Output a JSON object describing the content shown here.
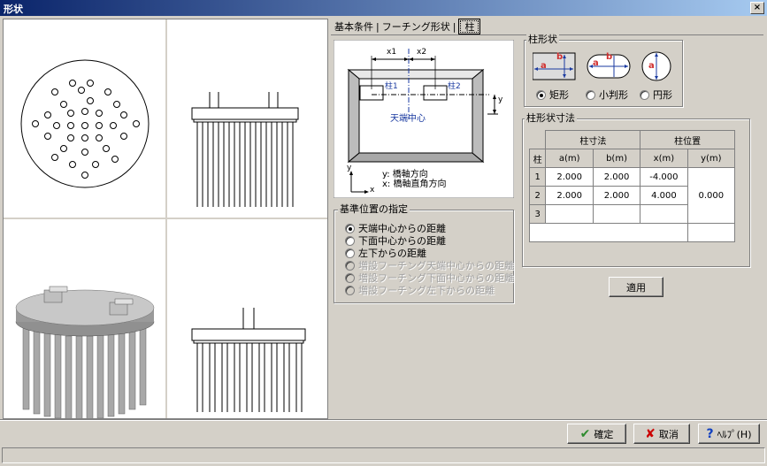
{
  "window": {
    "title": "形状",
    "close_glyph": "×"
  },
  "tabs": [
    {
      "label": "基本条件"
    },
    {
      "label": "フーチング形状"
    },
    {
      "label": "柱"
    }
  ],
  "diagram": {
    "x1": "x1",
    "x2": "x2",
    "y": "y",
    "col1": "柱1",
    "col2": "柱2",
    "center": "天端中心",
    "axis_y": "y",
    "axis_x": "x",
    "legend_y": "y: 橋軸方向",
    "legend_x": "x: 橋軸直角方向"
  },
  "column_shape": {
    "label": "柱形状",
    "icon_a": "a",
    "icon_b": "b",
    "options": [
      {
        "label": "矩形",
        "selected": true
      },
      {
        "label": "小判形",
        "selected": false
      },
      {
        "label": "円形",
        "selected": false
      }
    ]
  },
  "column_dims": {
    "label": "柱形状寸法",
    "header_col": "柱",
    "header_size": "柱寸法",
    "header_pos": "柱位置",
    "header_a": "a(m)",
    "header_b": "b(m)",
    "header_x": "x(m)",
    "header_y": "y(m)",
    "rows": [
      {
        "no": "1",
        "a": "2.000",
        "b": "2.000",
        "x": "-4.000"
      },
      {
        "no": "2",
        "a": "2.000",
        "b": "2.000",
        "x": "4.000"
      },
      {
        "no": "3",
        "a": "",
        "b": "",
        "x": ""
      }
    ],
    "y_value": "0.000"
  },
  "reference": {
    "label": "基準位置の指定",
    "options": [
      {
        "label": "天端中心からの距離",
        "selected": true,
        "enabled": true
      },
      {
        "label": "下面中心からの距離",
        "selected": false,
        "enabled": true
      },
      {
        "label": "左下からの距離",
        "selected": false,
        "enabled": true
      },
      {
        "label": "増設フーチング天端中心からの距離",
        "selected": false,
        "enabled": false
      },
      {
        "label": "増設フーチング下面中心からの距離",
        "selected": false,
        "enabled": false
      },
      {
        "label": "増設フーチング左下からの距離",
        "selected": false,
        "enabled": false
      }
    ]
  },
  "buttons": {
    "apply": "適用",
    "ok": "確定",
    "cancel": "取消",
    "help": "ﾍﾙﾌﾟ(H)",
    "help_icon": "?"
  },
  "colors": {
    "title_start": "#0a246a",
    "title_end": "#a6caf0",
    "check": "#2e8b2e",
    "cross": "#cc0000",
    "help": "#1040c0",
    "diagram_blue": "#1a3aa0",
    "label_red": "#d03030"
  }
}
